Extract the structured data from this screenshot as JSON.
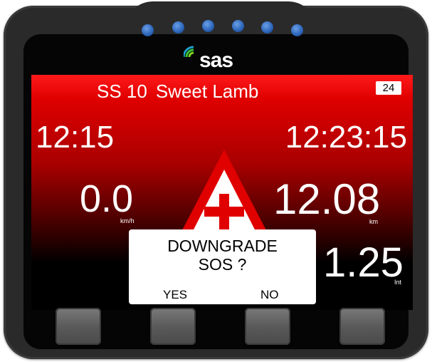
{
  "brand": {
    "logo_text": "sas"
  },
  "status": {
    "stage_number": "SS 10",
    "stage_name": "Sweet Lamb",
    "badge": "24"
  },
  "readouts": {
    "time_left": "12:15",
    "time_right": "12:23:15",
    "speed": "0.0",
    "speed_unit": "km/h",
    "distance": "12.08",
    "distance_unit": "km",
    "interval": "1.25",
    "interval_unit": "Int"
  },
  "dialog": {
    "line1": "DOWNGRADE",
    "line2": "SOS ?",
    "yes_label": "YES",
    "no_label": "NO"
  },
  "icons": {
    "warning": "red-cross-warning-triangle-icon",
    "leds": "blue-led-icon",
    "hardware_buttons": "hardware-button"
  },
  "colors": {
    "screen_red": "#e00000",
    "warning_red": "#e00000",
    "cross_red": "#e00000",
    "led_blue": "#2a63b8"
  }
}
